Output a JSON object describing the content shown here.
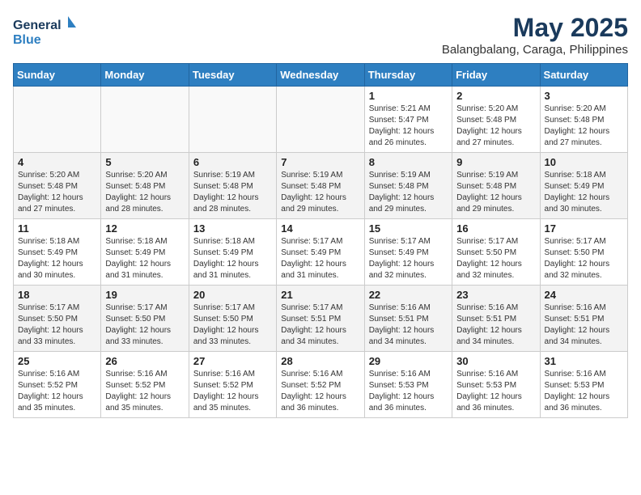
{
  "header": {
    "logo_line1": "General",
    "logo_line2": "Blue",
    "month_year": "May 2025",
    "location": "Balangbalang, Caraga, Philippines"
  },
  "days_of_week": [
    "Sunday",
    "Monday",
    "Tuesday",
    "Wednesday",
    "Thursday",
    "Friday",
    "Saturday"
  ],
  "weeks": [
    {
      "alt": false,
      "days": [
        {
          "num": "",
          "detail": ""
        },
        {
          "num": "",
          "detail": ""
        },
        {
          "num": "",
          "detail": ""
        },
        {
          "num": "",
          "detail": ""
        },
        {
          "num": "1",
          "detail": "Sunrise: 5:21 AM\nSunset: 5:47 PM\nDaylight: 12 hours\nand 26 minutes."
        },
        {
          "num": "2",
          "detail": "Sunrise: 5:20 AM\nSunset: 5:48 PM\nDaylight: 12 hours\nand 27 minutes."
        },
        {
          "num": "3",
          "detail": "Sunrise: 5:20 AM\nSunset: 5:48 PM\nDaylight: 12 hours\nand 27 minutes."
        }
      ]
    },
    {
      "alt": true,
      "days": [
        {
          "num": "4",
          "detail": "Sunrise: 5:20 AM\nSunset: 5:48 PM\nDaylight: 12 hours\nand 27 minutes."
        },
        {
          "num": "5",
          "detail": "Sunrise: 5:20 AM\nSunset: 5:48 PM\nDaylight: 12 hours\nand 28 minutes."
        },
        {
          "num": "6",
          "detail": "Sunrise: 5:19 AM\nSunset: 5:48 PM\nDaylight: 12 hours\nand 28 minutes."
        },
        {
          "num": "7",
          "detail": "Sunrise: 5:19 AM\nSunset: 5:48 PM\nDaylight: 12 hours\nand 29 minutes."
        },
        {
          "num": "8",
          "detail": "Sunrise: 5:19 AM\nSunset: 5:48 PM\nDaylight: 12 hours\nand 29 minutes."
        },
        {
          "num": "9",
          "detail": "Sunrise: 5:19 AM\nSunset: 5:48 PM\nDaylight: 12 hours\nand 29 minutes."
        },
        {
          "num": "10",
          "detail": "Sunrise: 5:18 AM\nSunset: 5:49 PM\nDaylight: 12 hours\nand 30 minutes."
        }
      ]
    },
    {
      "alt": false,
      "days": [
        {
          "num": "11",
          "detail": "Sunrise: 5:18 AM\nSunset: 5:49 PM\nDaylight: 12 hours\nand 30 minutes."
        },
        {
          "num": "12",
          "detail": "Sunrise: 5:18 AM\nSunset: 5:49 PM\nDaylight: 12 hours\nand 31 minutes."
        },
        {
          "num": "13",
          "detail": "Sunrise: 5:18 AM\nSunset: 5:49 PM\nDaylight: 12 hours\nand 31 minutes."
        },
        {
          "num": "14",
          "detail": "Sunrise: 5:17 AM\nSunset: 5:49 PM\nDaylight: 12 hours\nand 31 minutes."
        },
        {
          "num": "15",
          "detail": "Sunrise: 5:17 AM\nSunset: 5:49 PM\nDaylight: 12 hours\nand 32 minutes."
        },
        {
          "num": "16",
          "detail": "Sunrise: 5:17 AM\nSunset: 5:50 PM\nDaylight: 12 hours\nand 32 minutes."
        },
        {
          "num": "17",
          "detail": "Sunrise: 5:17 AM\nSunset: 5:50 PM\nDaylight: 12 hours\nand 32 minutes."
        }
      ]
    },
    {
      "alt": true,
      "days": [
        {
          "num": "18",
          "detail": "Sunrise: 5:17 AM\nSunset: 5:50 PM\nDaylight: 12 hours\nand 33 minutes."
        },
        {
          "num": "19",
          "detail": "Sunrise: 5:17 AM\nSunset: 5:50 PM\nDaylight: 12 hours\nand 33 minutes."
        },
        {
          "num": "20",
          "detail": "Sunrise: 5:17 AM\nSunset: 5:50 PM\nDaylight: 12 hours\nand 33 minutes."
        },
        {
          "num": "21",
          "detail": "Sunrise: 5:17 AM\nSunset: 5:51 PM\nDaylight: 12 hours\nand 34 minutes."
        },
        {
          "num": "22",
          "detail": "Sunrise: 5:16 AM\nSunset: 5:51 PM\nDaylight: 12 hours\nand 34 minutes."
        },
        {
          "num": "23",
          "detail": "Sunrise: 5:16 AM\nSunset: 5:51 PM\nDaylight: 12 hours\nand 34 minutes."
        },
        {
          "num": "24",
          "detail": "Sunrise: 5:16 AM\nSunset: 5:51 PM\nDaylight: 12 hours\nand 34 minutes."
        }
      ]
    },
    {
      "alt": false,
      "days": [
        {
          "num": "25",
          "detail": "Sunrise: 5:16 AM\nSunset: 5:52 PM\nDaylight: 12 hours\nand 35 minutes."
        },
        {
          "num": "26",
          "detail": "Sunrise: 5:16 AM\nSunset: 5:52 PM\nDaylight: 12 hours\nand 35 minutes."
        },
        {
          "num": "27",
          "detail": "Sunrise: 5:16 AM\nSunset: 5:52 PM\nDaylight: 12 hours\nand 35 minutes."
        },
        {
          "num": "28",
          "detail": "Sunrise: 5:16 AM\nSunset: 5:52 PM\nDaylight: 12 hours\nand 36 minutes."
        },
        {
          "num": "29",
          "detail": "Sunrise: 5:16 AM\nSunset: 5:53 PM\nDaylight: 12 hours\nand 36 minutes."
        },
        {
          "num": "30",
          "detail": "Sunrise: 5:16 AM\nSunset: 5:53 PM\nDaylight: 12 hours\nand 36 minutes."
        },
        {
          "num": "31",
          "detail": "Sunrise: 5:16 AM\nSunset: 5:53 PM\nDaylight: 12 hours\nand 36 minutes."
        }
      ]
    }
  ]
}
